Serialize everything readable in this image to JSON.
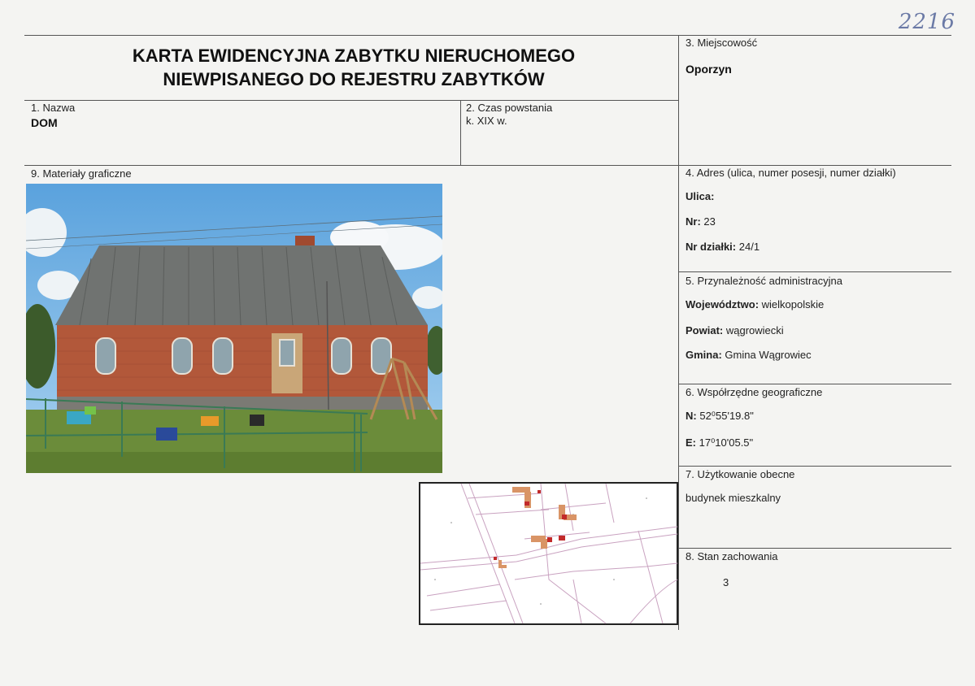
{
  "header": {
    "title_line1": "KARTA EWIDENCYJNA ZABYTKU NIERUCHOMEGO",
    "title_line2": "NIEWPISANEGO DO REJESTRU ZABYTKÓW",
    "stamp": "2216"
  },
  "fields": {
    "miejscowosc": {
      "label": "3. Miejscowość",
      "value": "Oporzyn"
    },
    "nazwa": {
      "label": "1. Nazwa",
      "value": "DOM"
    },
    "czas": {
      "label": "2. Czas powstania",
      "value": "k. XIX w."
    },
    "materialy": {
      "label": "9. Materiały graficzne"
    },
    "adres": {
      "label": "4. Adres (ulica, numer posesji, numer działki)",
      "ulica_key": "Ulica:",
      "ulica_val": "",
      "nr_key": "Nr:",
      "nr_val": "23",
      "dzialka_key": "Nr działki:",
      "dzialka_val": "24/1"
    },
    "administracja": {
      "label": "5. Przynależność administracyjna",
      "woj_key": "Województwo:",
      "woj_val": "wielkopolskie",
      "powiat_key": "Powiat:",
      "powiat_val": "wągrowiecki",
      "gmina_key": "Gmina:",
      "gmina_val": "Gmina Wągrowiec"
    },
    "wspolrzedne": {
      "label": "6. Współrzędne geograficzne",
      "n_key": "N:",
      "n_val": "52⁰55'19.8\"",
      "e_key": "E:",
      "e_val": "17⁰10'05.5\""
    },
    "uzytkowanie": {
      "label": "7. Użytkowanie obecne",
      "value": "budynek mieszkalny"
    },
    "stan": {
      "label": "8. Stan zachowania",
      "value": "3"
    }
  },
  "colors": {
    "roof": "#6f726f",
    "brick": "#b05838",
    "sky": "#7fb9e6",
    "grass": "#6b8c3a",
    "map_red": "#c22a2a",
    "map_orange": "#d99466"
  }
}
